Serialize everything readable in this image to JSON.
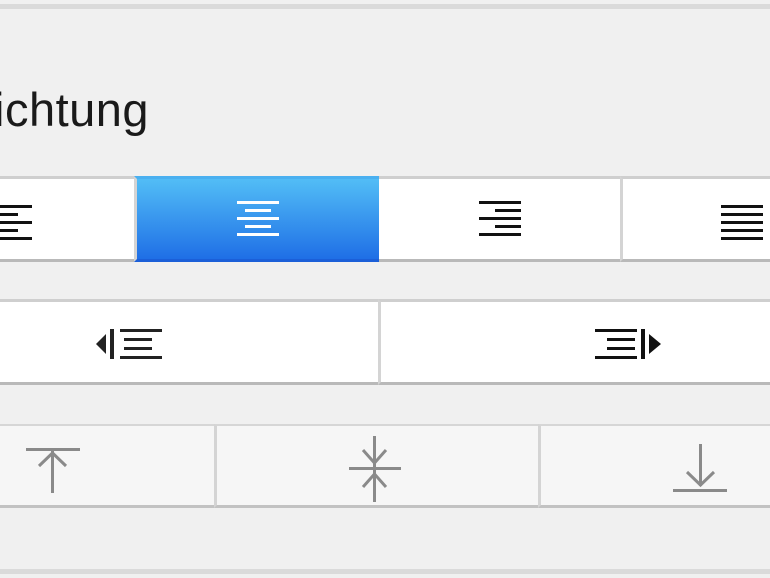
{
  "panel": {
    "heading": "ichtung"
  },
  "colors": {
    "selected_gradient_top": "#52bdf6",
    "selected_gradient_bottom": "#1f6fe6",
    "background": "#f0f0f0"
  },
  "alignment_row": {
    "buttons": [
      {
        "name": "align-left",
        "icon": "align-left-icon",
        "selected": false
      },
      {
        "name": "align-center",
        "icon": "align-center-icon",
        "selected": true
      },
      {
        "name": "align-right",
        "icon": "align-right-icon",
        "selected": false
      },
      {
        "name": "align-justify",
        "icon": "align-justify-icon",
        "selected": false
      }
    ]
  },
  "indent_row": {
    "buttons": [
      {
        "name": "decrease-indent",
        "icon": "outdent-icon"
      },
      {
        "name": "increase-indent",
        "icon": "indent-icon"
      }
    ]
  },
  "vertical_row": {
    "buttons": [
      {
        "name": "valign-top",
        "icon": "align-top-icon"
      },
      {
        "name": "valign-middle",
        "icon": "align-middle-icon"
      },
      {
        "name": "valign-bottom",
        "icon": "align-bottom-icon"
      }
    ]
  }
}
